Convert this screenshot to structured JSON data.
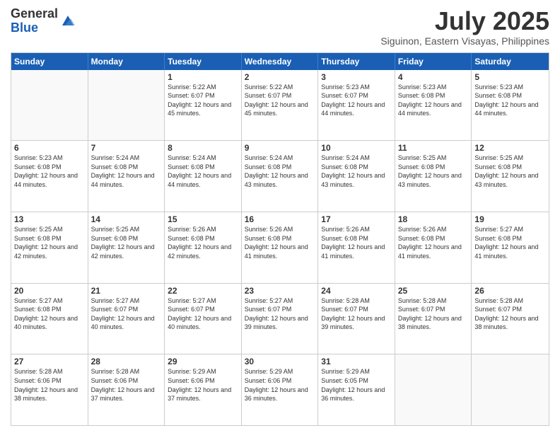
{
  "logo": {
    "general": "General",
    "blue": "Blue"
  },
  "title": "July 2025",
  "location": "Siguinon, Eastern Visayas, Philippines",
  "days": [
    "Sunday",
    "Monday",
    "Tuesday",
    "Wednesday",
    "Thursday",
    "Friday",
    "Saturday"
  ],
  "weeks": [
    [
      {
        "day": "",
        "sunrise": "",
        "sunset": "",
        "daylight": ""
      },
      {
        "day": "",
        "sunrise": "",
        "sunset": "",
        "daylight": ""
      },
      {
        "day": "1",
        "sunrise": "Sunrise: 5:22 AM",
        "sunset": "Sunset: 6:07 PM",
        "daylight": "Daylight: 12 hours and 45 minutes."
      },
      {
        "day": "2",
        "sunrise": "Sunrise: 5:22 AM",
        "sunset": "Sunset: 6:07 PM",
        "daylight": "Daylight: 12 hours and 45 minutes."
      },
      {
        "day": "3",
        "sunrise": "Sunrise: 5:23 AM",
        "sunset": "Sunset: 6:07 PM",
        "daylight": "Daylight: 12 hours and 44 minutes."
      },
      {
        "day": "4",
        "sunrise": "Sunrise: 5:23 AM",
        "sunset": "Sunset: 6:08 PM",
        "daylight": "Daylight: 12 hours and 44 minutes."
      },
      {
        "day": "5",
        "sunrise": "Sunrise: 5:23 AM",
        "sunset": "Sunset: 6:08 PM",
        "daylight": "Daylight: 12 hours and 44 minutes."
      }
    ],
    [
      {
        "day": "6",
        "sunrise": "Sunrise: 5:23 AM",
        "sunset": "Sunset: 6:08 PM",
        "daylight": "Daylight: 12 hours and 44 minutes."
      },
      {
        "day": "7",
        "sunrise": "Sunrise: 5:24 AM",
        "sunset": "Sunset: 6:08 PM",
        "daylight": "Daylight: 12 hours and 44 minutes."
      },
      {
        "day": "8",
        "sunrise": "Sunrise: 5:24 AM",
        "sunset": "Sunset: 6:08 PM",
        "daylight": "Daylight: 12 hours and 44 minutes."
      },
      {
        "day": "9",
        "sunrise": "Sunrise: 5:24 AM",
        "sunset": "Sunset: 6:08 PM",
        "daylight": "Daylight: 12 hours and 43 minutes."
      },
      {
        "day": "10",
        "sunrise": "Sunrise: 5:24 AM",
        "sunset": "Sunset: 6:08 PM",
        "daylight": "Daylight: 12 hours and 43 minutes."
      },
      {
        "day": "11",
        "sunrise": "Sunrise: 5:25 AM",
        "sunset": "Sunset: 6:08 PM",
        "daylight": "Daylight: 12 hours and 43 minutes."
      },
      {
        "day": "12",
        "sunrise": "Sunrise: 5:25 AM",
        "sunset": "Sunset: 6:08 PM",
        "daylight": "Daylight: 12 hours and 43 minutes."
      }
    ],
    [
      {
        "day": "13",
        "sunrise": "Sunrise: 5:25 AM",
        "sunset": "Sunset: 6:08 PM",
        "daylight": "Daylight: 12 hours and 42 minutes."
      },
      {
        "day": "14",
        "sunrise": "Sunrise: 5:25 AM",
        "sunset": "Sunset: 6:08 PM",
        "daylight": "Daylight: 12 hours and 42 minutes."
      },
      {
        "day": "15",
        "sunrise": "Sunrise: 5:26 AM",
        "sunset": "Sunset: 6:08 PM",
        "daylight": "Daylight: 12 hours and 42 minutes."
      },
      {
        "day": "16",
        "sunrise": "Sunrise: 5:26 AM",
        "sunset": "Sunset: 6:08 PM",
        "daylight": "Daylight: 12 hours and 41 minutes."
      },
      {
        "day": "17",
        "sunrise": "Sunrise: 5:26 AM",
        "sunset": "Sunset: 6:08 PM",
        "daylight": "Daylight: 12 hours and 41 minutes."
      },
      {
        "day": "18",
        "sunrise": "Sunrise: 5:26 AM",
        "sunset": "Sunset: 6:08 PM",
        "daylight": "Daylight: 12 hours and 41 minutes."
      },
      {
        "day": "19",
        "sunrise": "Sunrise: 5:27 AM",
        "sunset": "Sunset: 6:08 PM",
        "daylight": "Daylight: 12 hours and 41 minutes."
      }
    ],
    [
      {
        "day": "20",
        "sunrise": "Sunrise: 5:27 AM",
        "sunset": "Sunset: 6:08 PM",
        "daylight": "Daylight: 12 hours and 40 minutes."
      },
      {
        "day": "21",
        "sunrise": "Sunrise: 5:27 AM",
        "sunset": "Sunset: 6:07 PM",
        "daylight": "Daylight: 12 hours and 40 minutes."
      },
      {
        "day": "22",
        "sunrise": "Sunrise: 5:27 AM",
        "sunset": "Sunset: 6:07 PM",
        "daylight": "Daylight: 12 hours and 40 minutes."
      },
      {
        "day": "23",
        "sunrise": "Sunrise: 5:27 AM",
        "sunset": "Sunset: 6:07 PM",
        "daylight": "Daylight: 12 hours and 39 minutes."
      },
      {
        "day": "24",
        "sunrise": "Sunrise: 5:28 AM",
        "sunset": "Sunset: 6:07 PM",
        "daylight": "Daylight: 12 hours and 39 minutes."
      },
      {
        "day": "25",
        "sunrise": "Sunrise: 5:28 AM",
        "sunset": "Sunset: 6:07 PM",
        "daylight": "Daylight: 12 hours and 38 minutes."
      },
      {
        "day": "26",
        "sunrise": "Sunrise: 5:28 AM",
        "sunset": "Sunset: 6:07 PM",
        "daylight": "Daylight: 12 hours and 38 minutes."
      }
    ],
    [
      {
        "day": "27",
        "sunrise": "Sunrise: 5:28 AM",
        "sunset": "Sunset: 6:06 PM",
        "daylight": "Daylight: 12 hours and 38 minutes."
      },
      {
        "day": "28",
        "sunrise": "Sunrise: 5:28 AM",
        "sunset": "Sunset: 6:06 PM",
        "daylight": "Daylight: 12 hours and 37 minutes."
      },
      {
        "day": "29",
        "sunrise": "Sunrise: 5:29 AM",
        "sunset": "Sunset: 6:06 PM",
        "daylight": "Daylight: 12 hours and 37 minutes."
      },
      {
        "day": "30",
        "sunrise": "Sunrise: 5:29 AM",
        "sunset": "Sunset: 6:06 PM",
        "daylight": "Daylight: 12 hours and 36 minutes."
      },
      {
        "day": "31",
        "sunrise": "Sunrise: 5:29 AM",
        "sunset": "Sunset: 6:05 PM",
        "daylight": "Daylight: 12 hours and 36 minutes."
      },
      {
        "day": "",
        "sunrise": "",
        "sunset": "",
        "daylight": ""
      },
      {
        "day": "",
        "sunrise": "",
        "sunset": "",
        "daylight": ""
      }
    ]
  ]
}
